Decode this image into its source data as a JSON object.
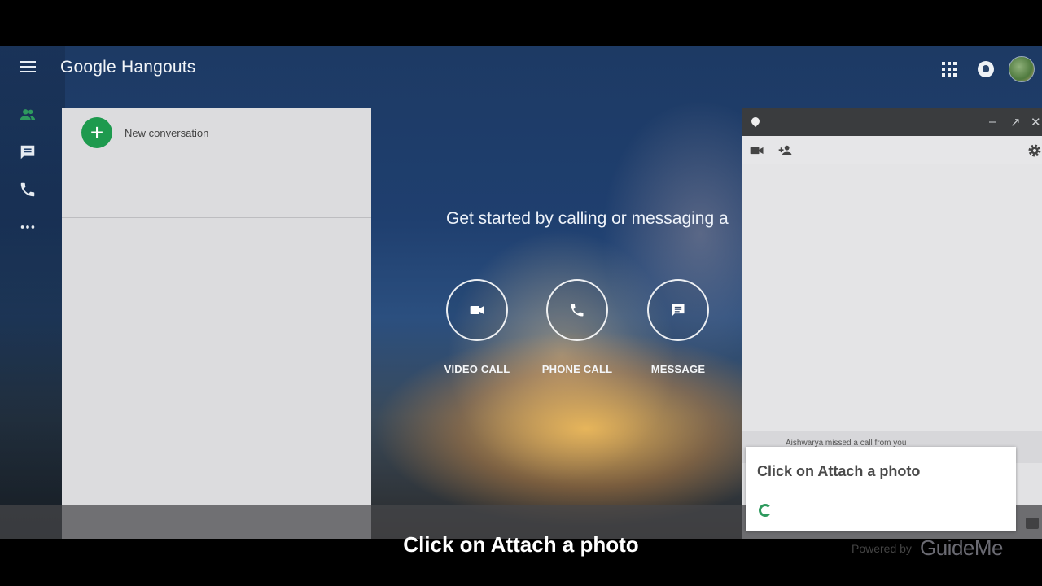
{
  "app": {
    "brand": "Google Hangouts"
  },
  "conversations": {
    "new_label": "New conversation"
  },
  "center": {
    "headline": "Get started by calling or messaging a",
    "actions": [
      {
        "label": "VIDEO CALL",
        "icon": "video-camera-icon"
      },
      {
        "label": "PHONE CALL",
        "icon": "phone-icon"
      },
      {
        "label": "MESSAGE",
        "icon": "message-icon"
      }
    ]
  },
  "chat": {
    "controls": {
      "minimize": "–",
      "popout": "↗",
      "close": "✕"
    },
    "missed_call": "Aishwarya missed a call from you"
  },
  "tooltip": {
    "text": "Click on Attach a photo"
  },
  "caption": {
    "text": "Click on Attach a photo"
  },
  "watermark": {
    "prefix": "Powered by",
    "brand": "GuideMe"
  },
  "colors": {
    "accent_green": "#1e9a4e",
    "rail_green": "#2e9a5e"
  }
}
